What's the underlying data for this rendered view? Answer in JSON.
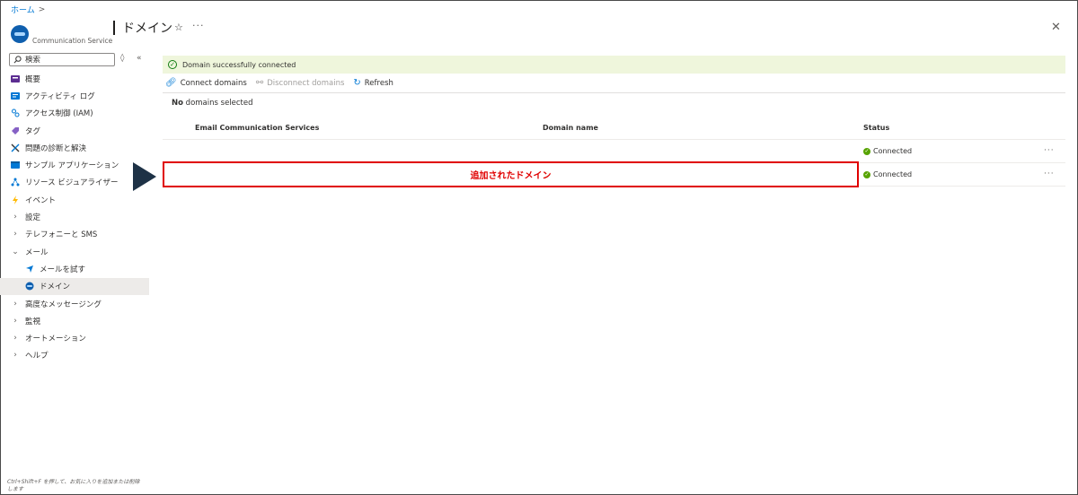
{
  "breadcrumb": {
    "home": "ホーム",
    "separator": ">"
  },
  "header": {
    "service_type": "Communication Service",
    "title": "ドメイン",
    "star_glyph": "☆",
    "more_glyph": "···",
    "close_glyph": "✕"
  },
  "sidebar": {
    "search_placeholder": "検索",
    "items": [
      {
        "label": "概要",
        "icon": "overview-icon"
      },
      {
        "label": "アクティビティ ログ",
        "icon": "activity-log-icon"
      },
      {
        "label": "アクセス制御 (IAM)",
        "icon": "iam-icon"
      },
      {
        "label": "タグ",
        "icon": "tag-icon"
      },
      {
        "label": "問題の診断と解決",
        "icon": "diagnose-icon"
      },
      {
        "label": "サンプル アプリケーション",
        "icon": "sample-app-icon"
      },
      {
        "label": "リソース ビジュアライザー",
        "icon": "resource-visualizer-icon"
      },
      {
        "label": "イベント",
        "icon": "event-icon"
      },
      {
        "label": "設定",
        "icon": "chevron-right-icon"
      },
      {
        "label": "テレフォニーと SMS",
        "icon": "chevron-right-icon"
      },
      {
        "label": "メール",
        "icon": "chevron-down-icon"
      },
      {
        "label": "メールを試す",
        "icon": "try-email-icon"
      },
      {
        "label": "ドメイン",
        "icon": "domain-icon"
      },
      {
        "label": "高度なメッセージング",
        "icon": "chevron-right-icon"
      },
      {
        "label": "監視",
        "icon": "chevron-right-icon"
      },
      {
        "label": "オートメーション",
        "icon": "chevron-right-icon"
      },
      {
        "label": "ヘルプ",
        "icon": "chevron-right-icon"
      }
    ],
    "footer_hint": "Ctrl+Shift+F を押して、お気に入りを追加または削除します"
  },
  "main": {
    "banner": "Domain successfully connected",
    "toolbar": {
      "connect": "Connect domains",
      "disconnect": "Disconnect domains",
      "refresh": "Refresh"
    },
    "selection": {
      "count": "No",
      "suffix": " domains selected"
    },
    "table": {
      "columns": [
        "Email Communication Services",
        "Domain name",
        "Status"
      ],
      "rows": [
        {
          "status": "Connected"
        },
        {
          "status": "Connected"
        }
      ]
    },
    "annotation": "追加されたドメイン"
  },
  "colors": {
    "accent": "#0078d4",
    "success": "#57a300",
    "annotation_red": "#e00000",
    "arrow": "#1e3246",
    "banner_bg": "#eff6dc"
  }
}
